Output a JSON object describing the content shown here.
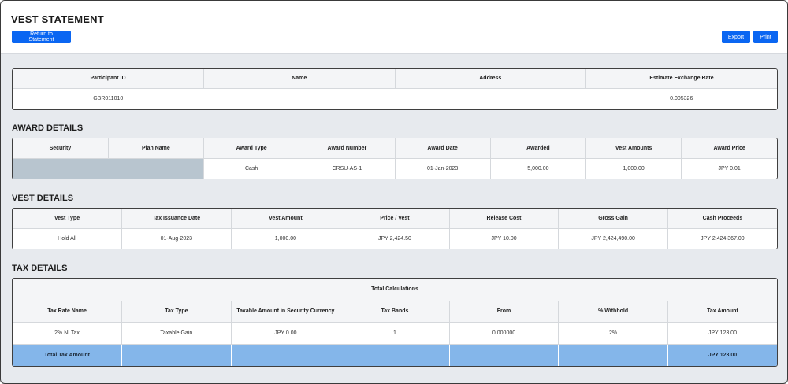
{
  "header": {
    "title": "VEST STATEMENT",
    "return_label": "Return to Statement",
    "export_label": "Export",
    "print_label": "Print"
  },
  "participant": {
    "columns": [
      "Participant ID",
      "Name",
      "Address",
      "Estimate Exchange Rate"
    ],
    "row": [
      "GBR011010",
      "",
      "",
      "0.005326"
    ]
  },
  "award": {
    "title": "AWARD DETAILS",
    "columns": [
      "Security",
      "Plan Name",
      "Award Type",
      "Award Number",
      "Award Date",
      "Awarded",
      "Vest Amounts",
      "Award Price"
    ],
    "row": [
      "",
      "",
      "Cash",
      "CRSU-AS-1",
      "01-Jan-2023",
      "5,000.00",
      "1,000.00",
      "JPY 0.01"
    ]
  },
  "vest": {
    "title": "VEST DETAILS",
    "columns": [
      "Vest Type",
      "Tax Issuance Date",
      "Vest Amount",
      "Price / Vest",
      "Release Cost",
      "Gross Gain",
      "Cash Proceeds"
    ],
    "row": [
      "Hold All",
      "01-Aug-2023",
      "1,000.00",
      "JPY 2,424.50",
      "JPY 10.00",
      "JPY 2,424,490.00",
      "JPY 2,424,367.00"
    ]
  },
  "tax": {
    "title": "TAX DETAILS",
    "caption": "Total Calculations",
    "columns": [
      "Tax Rate Name",
      "Tax Type",
      "Taxable Amount in Security Currency",
      "Tax Bands",
      "From",
      "% Withhold",
      "Tax Amount"
    ],
    "row": [
      "2% NI Tax",
      "Taxable Gain",
      "JPY 0.00",
      "1",
      "0.000000",
      "2%",
      "JPY 123.00"
    ],
    "total": [
      "Total Tax Amount",
      "",
      "",
      "",
      "",
      "",
      "JPY 123.00"
    ]
  },
  "colors": {
    "accent": "#0a66f2",
    "total_row": "#84b6ea",
    "security_cell": "#b8c5cf",
    "background": "#e7eaee"
  }
}
